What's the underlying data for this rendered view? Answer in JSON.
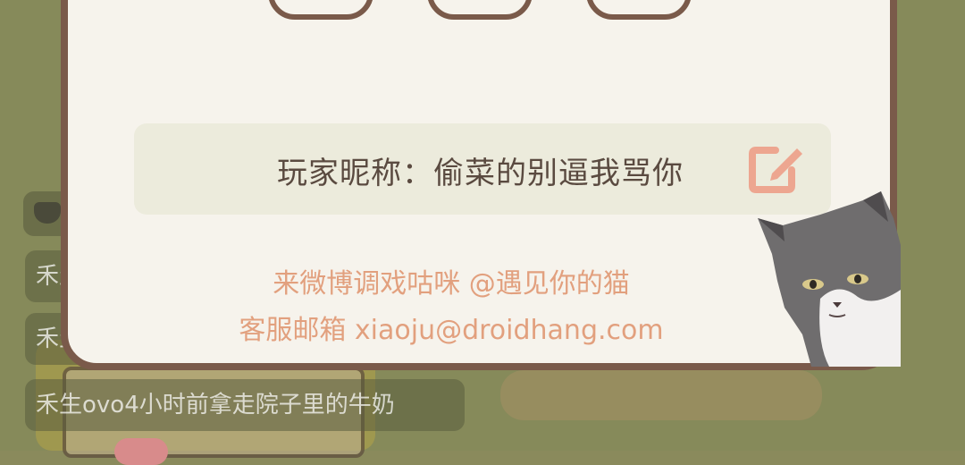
{
  "profile": {
    "nickname_label": "玩家昵称：偷菜的别逼我骂你",
    "weibo_text": "来微博调戏咕咪 @遇见你的猫",
    "email_text": "客服邮箱 xiaoju@droidhang.com"
  },
  "feed": {
    "items": [
      "禾生",
      "禾生",
      "禾生ovo4小时前拿走院子里的牛奶"
    ]
  },
  "colors": {
    "frame": "#7a5a4a",
    "panel": "#f6f3ec",
    "accent": "#e2a07e",
    "edit_icon": "#eda690"
  }
}
